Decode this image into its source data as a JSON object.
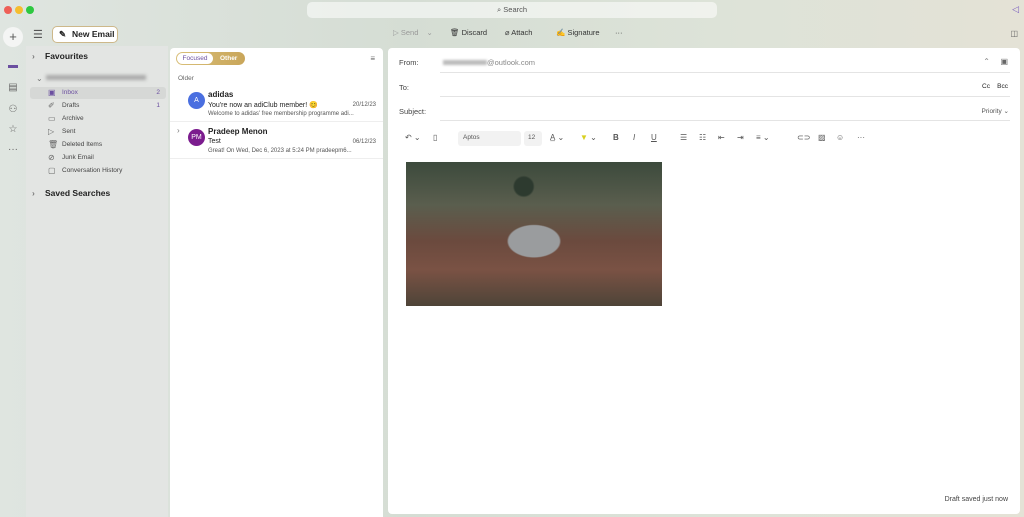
{
  "window": {
    "search_placeholder": "Search"
  },
  "toolbar": {
    "new_email": "New Email",
    "send": "Send",
    "discard": "Discard",
    "attach": "Attach",
    "signature": "Signature",
    "more": "···"
  },
  "sidebar": {
    "favourites": "Favourites",
    "saved_searches": "Saved Searches",
    "folders": [
      {
        "label": "Inbox",
        "count": "2"
      },
      {
        "label": "Drafts",
        "count": "1"
      },
      {
        "label": "Archive",
        "count": ""
      },
      {
        "label": "Sent",
        "count": ""
      },
      {
        "label": "Deleted Items",
        "count": ""
      },
      {
        "label": "Junk Email",
        "count": ""
      },
      {
        "label": "Conversation History",
        "count": ""
      }
    ]
  },
  "list": {
    "tab_focused": "Focused",
    "tab_other": "Other",
    "group": "Older",
    "messages": [
      {
        "initials": "A",
        "sender": "adidas",
        "subject": "You're now an adiClub member! 😊",
        "date": "20/12/23",
        "preview": "Welcome to adidas' free membership programme adi...",
        "color": "#4a6fe0"
      },
      {
        "initials": "PM",
        "sender": "Pradeep Menon",
        "subject": "Test",
        "date": "06/12/23",
        "preview": "Great! On Wed, Dec 6, 2023 at 5:24 PM pradeepm6...",
        "color": "#7b1c8e"
      }
    ]
  },
  "compose": {
    "from_label": "From:",
    "from_value": "@outlook.com",
    "to_label": "To:",
    "subject_label": "Subject:",
    "cc": "Cc",
    "bcc": "Bcc",
    "priority": "Priority",
    "font": "Aptos",
    "size": "12",
    "status": "Draft saved just now"
  }
}
